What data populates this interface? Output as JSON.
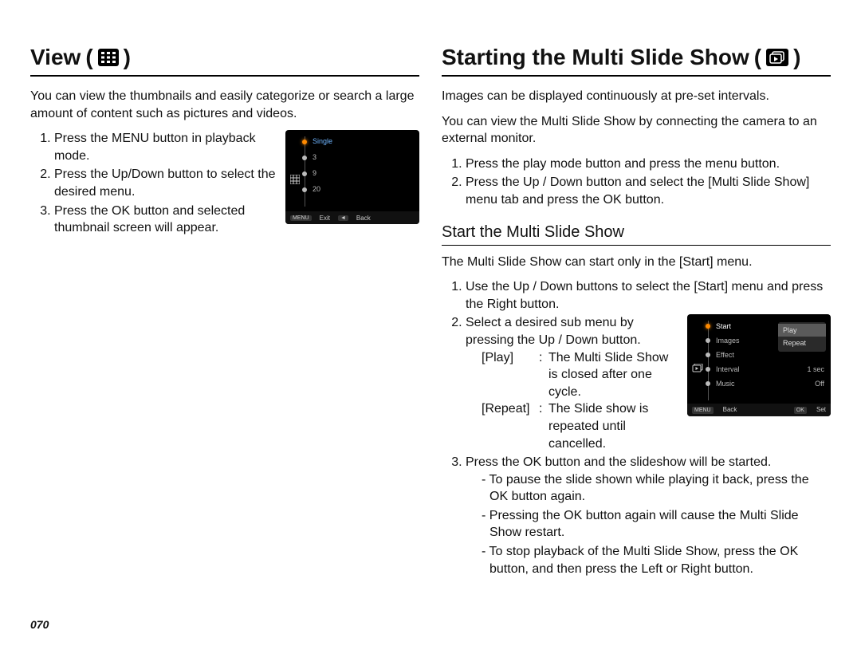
{
  "page_number": "070",
  "left": {
    "title": "View",
    "paren_open": "(",
    "paren_close": ")",
    "intro": "You can view the thumbnails and easily categorize or search a large amount of content such as pictures and videos.",
    "steps": [
      "Press the MENU button in playback mode.",
      "Press the Up/Down button to select the desired menu.",
      "Press the OK button and selected thumbnail screen will appear."
    ],
    "lcd": {
      "rows": [
        "Single",
        "3",
        "9",
        "20"
      ],
      "bottom": {
        "exit_chip": "MENU",
        "exit_label": "Exit",
        "back_chip": "◄",
        "back_label": "Back"
      }
    }
  },
  "right": {
    "title": "Starting the Multi Slide Show",
    "paren_open": "(",
    "paren_close": ")",
    "intro1": "Images can be displayed continuously at pre-set intervals.",
    "intro2": "You can view the Multi Slide Show by connecting the camera to an external monitor.",
    "top_steps": [
      "Press the play mode button and press the menu button.",
      "Press the Up / Down button and select the [Multi Slide Show] menu tab and press the OK button."
    ],
    "subheading": "Start the Multi Slide Show",
    "sub_intro": "The Multi Slide Show can start only in the [Start] menu.",
    "sub_step1": "Use the Up / Down buttons to select the [Start] menu and press the Right button.",
    "sub_step2": "Select a desired sub menu by pressing the Up / Down button.",
    "options": [
      {
        "key": "[Play]",
        "desc": "The Multi Slide Show is closed after one cycle."
      },
      {
        "key": "[Repeat]",
        "desc": "The Slide show is repeated until cancelled."
      }
    ],
    "sub_step3": "Press the OK button and the slideshow will be started.",
    "dashes": [
      "To pause the slide shown while playing it back, press the OK button again.",
      "Pressing the OK button again will cause the Multi Slide Show restart.",
      "To stop playback of the Multi Slide Show, press the OK button, and then press the Left or Right button."
    ],
    "lcd": {
      "menu": [
        "Start",
        "Images",
        "Effect",
        "Interval",
        "Music"
      ],
      "vals": {
        "Interval": "1 sec",
        "Music": "Off"
      },
      "popup": [
        "Play",
        "Repeat"
      ],
      "bottom": {
        "back_chip": "MENU",
        "back_label": "Back",
        "set_chip": "OK",
        "set_label": "Set"
      }
    }
  }
}
